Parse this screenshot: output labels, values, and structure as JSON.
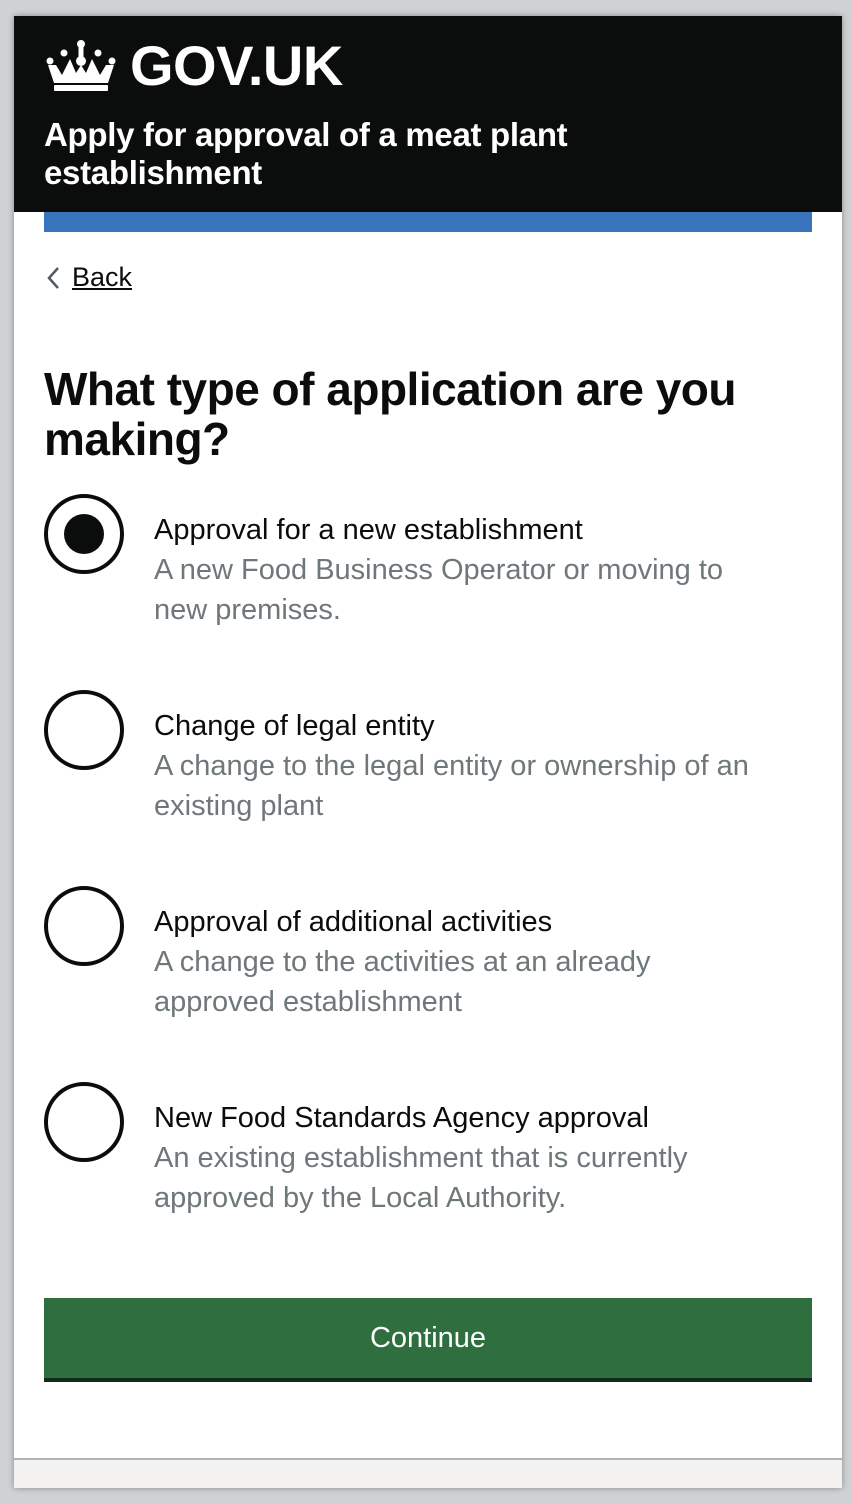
{
  "header": {
    "logo_text": "GOV.UK",
    "service_name": "Apply for approval of a meat plant establishment"
  },
  "back_link": {
    "label": "Back"
  },
  "question": {
    "heading": "What type of application are you making?"
  },
  "options": [
    {
      "label": "Approval for a new establishment",
      "hint": "A new Food Business Operator or moving to new premises.",
      "selected": true
    },
    {
      "label": "Change of legal entity",
      "hint": "A change to the legal entity or ownership of an existing plant",
      "selected": false
    },
    {
      "label": "Approval of additional activities",
      "hint": "A change to the activities at an already approved establishment",
      "selected": false
    },
    {
      "label": "New Food Standards Agency approval",
      "hint": "An existing establishment that is currently approved by the Local Authority.",
      "selected": false
    }
  ],
  "continue_button": {
    "label": "Continue"
  },
  "colors": {
    "header_bg": "#0b0c0c",
    "accent_bar": "#3a74bd",
    "button_bg": "#2f6e3f",
    "hint_text": "#6f777b"
  }
}
